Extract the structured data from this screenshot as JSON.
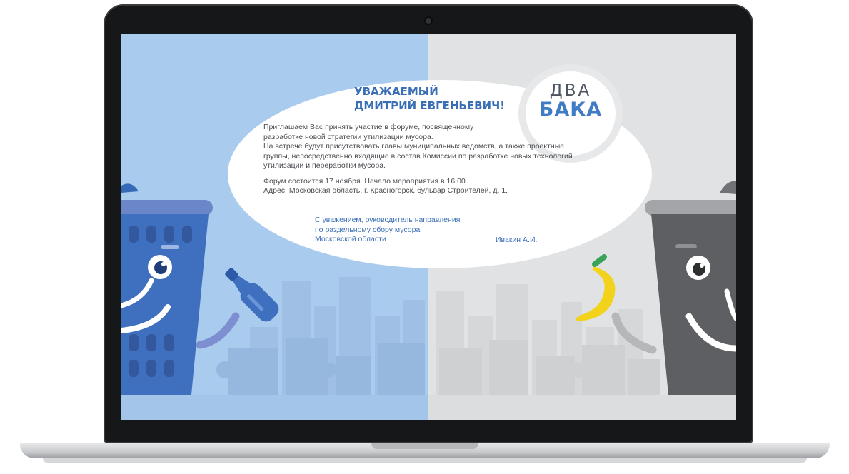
{
  "colors": {
    "left_background": "#a9cbee",
    "right_background": "#e1e2e3",
    "accent_blue": "#3a6fb5",
    "logo_blue": "#3f7cc4",
    "body_text": "#4a4d52",
    "bin_blue": "#3f6fbf",
    "bin_gray": "#5d5f62",
    "banana": "#f2d21b"
  },
  "logo": {
    "top": "ДВА",
    "bottom": "БАКА"
  },
  "headline": {
    "line1": "УВАЖАЕМЫЙ",
    "line2": "ДМИТРИЙ ЕВГЕНЬЕВИЧ!"
  },
  "body": {
    "lines": [
      "Приглашаем Вас принять участие в форуме, посвященному",
      "разработке новой стратегии утилизации мусора.",
      "На встрече будут присутствовать главы муниципальных ведомств, а также проектные",
      "группы, непосредственно входящие в состав Комиссии по разработке новых технологий",
      "утилизации и переработки мусора."
    ],
    "event_lines": [
      "Форум состоится 17 ноября. Начало мероприятия в 16.00.",
      "Адрес: Московская область, г. Красногорск, бульвар Строителей, д. 1."
    ]
  },
  "signature": {
    "lines": [
      "С уважением, руководитель направления",
      "по раздельному сбору мусора",
      "Московской области"
    ],
    "name": "Ивакин А.И."
  },
  "illustration": {
    "left_bin": "blue-trash-bin-character",
    "left_item": "bottle-icon",
    "right_bin": "gray-trash-bin-character",
    "right_item": "banana-icon"
  }
}
